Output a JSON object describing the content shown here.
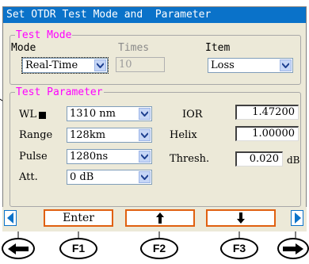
{
  "window": {
    "title": "Set OTDR Test Mode and  Parameter"
  },
  "test_mode": {
    "legend": "Test Mode",
    "mode_label": "Mode",
    "times_label": "Times",
    "item_label": "Item",
    "mode_value": "Real-Time",
    "times_value": "10",
    "item_value": "Loss"
  },
  "test_parameter": {
    "legend": "Test Parameter",
    "wl_label": "WL",
    "wl_value": "1310 nm",
    "range_label": "Range",
    "range_value": "128km",
    "pulse_label": "Pulse",
    "pulse_value": "1280ns",
    "att_label": "Att.",
    "att_value": "0 dB",
    "ior_label": "IOR",
    "ior_value": "1.47200",
    "helix_label": "Helix",
    "helix_value": "1.00000",
    "thresh_label": "Thresh.",
    "thresh_value": "0.020",
    "thresh_unit": "dB"
  },
  "softkeys": {
    "f1_label": "Enter",
    "f2_icon": "up-arrow-icon",
    "f3_icon": "down-arrow-icon",
    "left_icon": "left-triangle-icon",
    "right_icon": "right-triangle-icon"
  },
  "hardware_keys": {
    "f1": "F1",
    "f2": "F2",
    "f3": "F3",
    "left_icon": "left-arrow-icon",
    "right_icon": "right-arrow-icon"
  },
  "colors": {
    "titlebar": "#0a72c9",
    "legend": "#ff00ff",
    "softkey_border": "#e06010",
    "window_bg": "#ece9d8"
  }
}
